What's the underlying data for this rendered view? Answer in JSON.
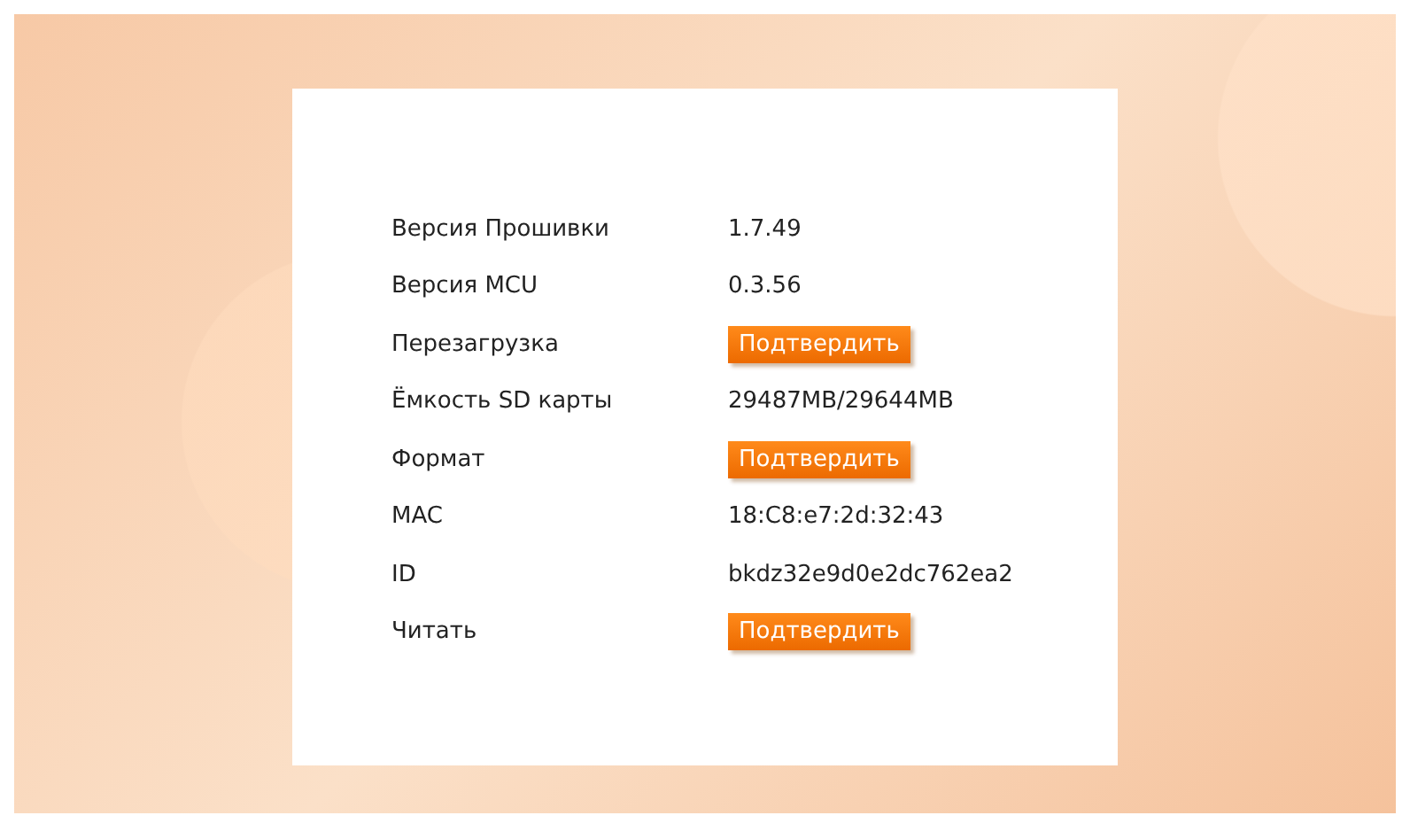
{
  "rows": [
    {
      "kind": "value",
      "label": "Версия Прошивки",
      "value": "1.7.49"
    },
    {
      "kind": "value",
      "label": "Версия MCU",
      "value": "0.3.56"
    },
    {
      "kind": "button",
      "label": "Перезагрузка",
      "value": "Подтвердить"
    },
    {
      "kind": "value",
      "label": "Ёмкость SD карты",
      "value": "29487MB/29644MB"
    },
    {
      "kind": "button",
      "label": "Формат",
      "value": "Подтвердить"
    },
    {
      "kind": "value",
      "label": "MAC",
      "value": "18:C8:e7:2d:32:43"
    },
    {
      "kind": "value",
      "label": "ID",
      "value": "bkdz32e9d0e2dc762ea2"
    },
    {
      "kind": "button",
      "label": "Читать",
      "value": "Подтвердить"
    }
  ]
}
